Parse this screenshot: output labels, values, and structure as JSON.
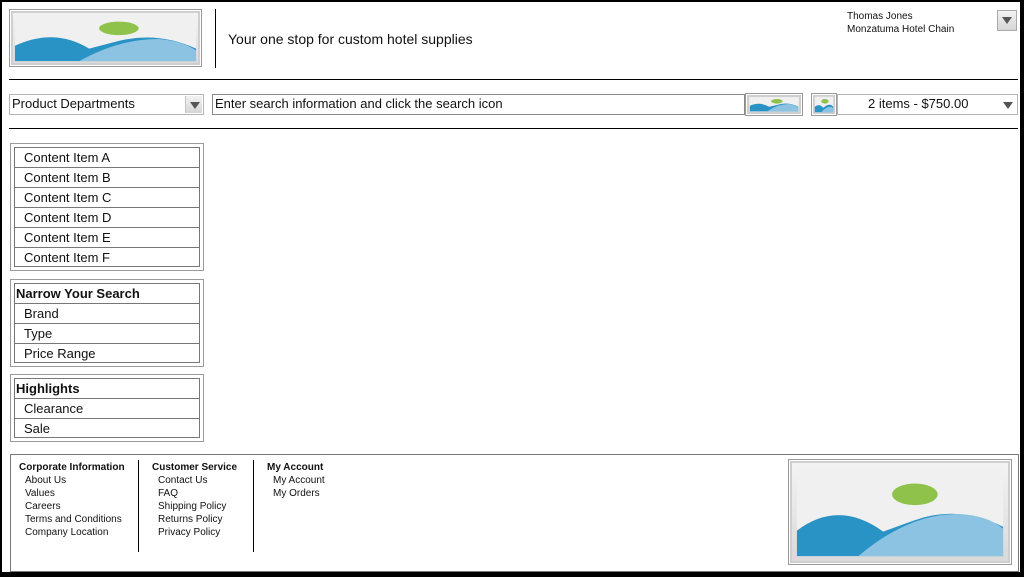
{
  "header": {
    "tagline": "Your one stop for custom hotel supplies",
    "user_name": "Thomas Jones",
    "user_company": "Monzatuma Hotel Chain"
  },
  "toolbar": {
    "departments_label": "Product Departments",
    "search_text": "Enter search information and click the search icon",
    "cart_summary": "2 items - $750.00"
  },
  "sidebar": {
    "content_items": [
      "Content Item A",
      "Content Item B",
      "Content Item C",
      "Content Item D",
      "Content Item E",
      "Content Item F"
    ],
    "narrow": {
      "title": "Narrow Your Search",
      "items": [
        "Brand",
        "Type",
        "Price Range"
      ]
    },
    "highlights": {
      "title": "Highlights",
      "items": [
        "Clearance",
        "Sale"
      ]
    }
  },
  "footer": {
    "columns": [
      {
        "title": "Corporate Information",
        "links": [
          "About Us",
          "Values",
          "Careers",
          "Terms and Conditions",
          "Company Location"
        ]
      },
      {
        "title": "Customer Service",
        "links": [
          "Contact Us",
          "FAQ",
          "Shipping Policy",
          "Returns Policy",
          "Privacy Policy"
        ]
      },
      {
        "title": "My Account",
        "links": [
          "My Account",
          "My Orders"
        ]
      }
    ]
  },
  "colors": {
    "sky": "#ececec",
    "hill_dark": "#2a93c6",
    "hill_light": "#8cc3e2",
    "sun": "#8fc24a",
    "rule": "#000000"
  }
}
